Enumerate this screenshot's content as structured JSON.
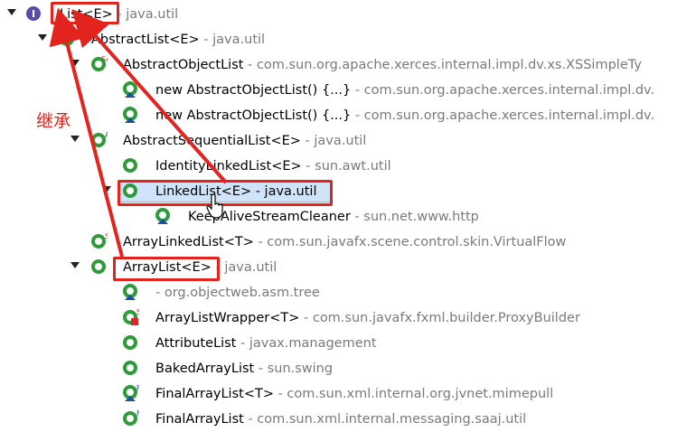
{
  "rows": [
    {
      "name": "List<E>",
      "pkg": " - java.util"
    },
    {
      "name": "AbstractList<E>",
      "pkg": " - java.util"
    },
    {
      "name": "AbstractObjectList",
      "pkg": " - com.sun.org.apache.xerces.internal.impl.dv.xs.XSSimpleTy"
    },
    {
      "name": "new AbstractObjectList() {...}",
      "pkg": " - com.sun.org.apache.xerces.internal.impl.dv."
    },
    {
      "name": "new AbstractObjectList() {...}",
      "pkg": " - com.sun.org.apache.xerces.internal.impl.dv."
    },
    {
      "name": "AbstractSequentialList<E>",
      "pkg": " - java.util"
    },
    {
      "name": "IdentityLinkedList<E>",
      "pkg": " - sun.awt.util"
    },
    {
      "name": "LinkedList<E> - java.util",
      "pkg": ""
    },
    {
      "name": "KeepAliveStreamCleaner",
      "pkg": " - sun.net.www.http"
    },
    {
      "name": "ArrayLinkedList<T>",
      "pkg": " - com.sun.javafx.scene.control.skin.VirtualFlow"
    },
    {
      "name": "ArrayList<E>",
      "pkg": " - java.util"
    },
    {
      "name": "",
      "pkg": " - org.objectweb.asm.tree"
    },
    {
      "name": "ArrayListWrapper<T>",
      "pkg": " - com.sun.javafx.fxml.builder.ProxyBuilder"
    },
    {
      "name": "AttributeList",
      "pkg": " - javax.management"
    },
    {
      "name": "BakedArrayList",
      "pkg": " - sun.swing"
    },
    {
      "name": "FinalArrayList<T>",
      "pkg": " - com.sun.xml.internal.org.jvnet.mimepull"
    },
    {
      "name": "FinalArrayList",
      "pkg": " - com.sun.xml.internal.messaging.saaj.util"
    }
  ],
  "annotation": {
    "inherit_label": "继承"
  },
  "icon_badges": {
    "abstract": "A",
    "static_abstract": "SA",
    "static": "S",
    "final": "F"
  },
  "colors": {
    "highlight_red": "#e3231d",
    "class_green": "#2e9b3a",
    "interface_purple": "#5b4aa8",
    "selection": "#cfe4f8"
  }
}
